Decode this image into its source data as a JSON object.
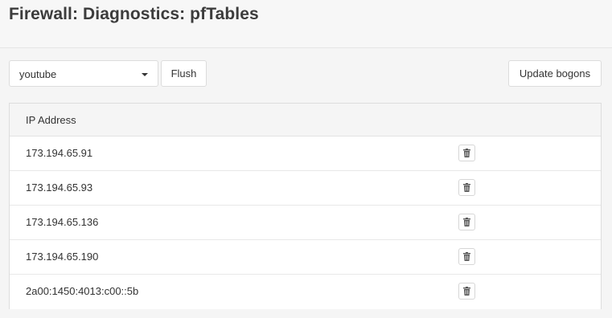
{
  "header": {
    "title": "Firewall: Diagnostics: pfTables"
  },
  "toolbar": {
    "table_select": {
      "value": "youtube"
    },
    "flush_label": "Flush",
    "update_bogons_label": "Update bogons"
  },
  "table": {
    "columns": [
      "IP Address"
    ],
    "rows": [
      {
        "ip": "173.194.65.91"
      },
      {
        "ip": "173.194.65.93"
      },
      {
        "ip": "173.194.65.136"
      },
      {
        "ip": "173.194.65.190"
      },
      {
        "ip": "2a00:1450:4013:c00::5b"
      }
    ],
    "row_action_icon": "trash-icon"
  }
}
